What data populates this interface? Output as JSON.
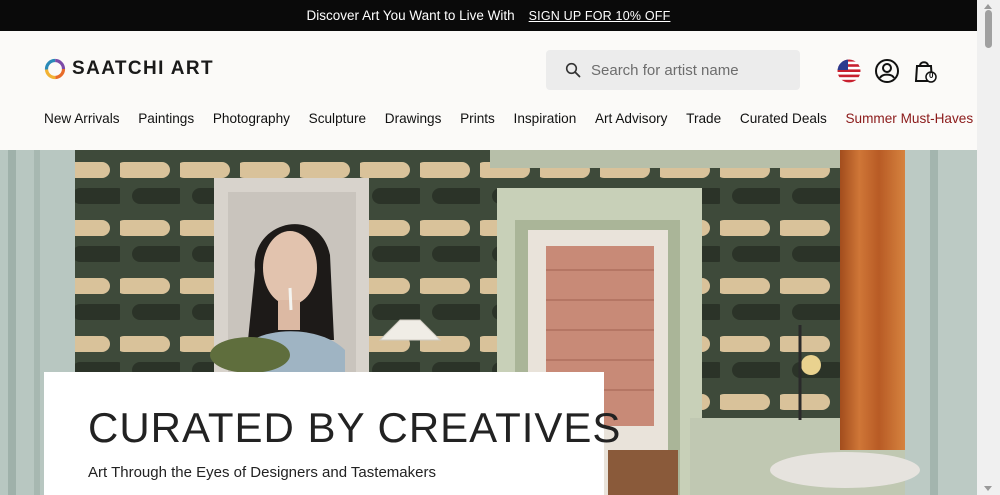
{
  "promo": {
    "message": "Discover Art You Want to Live With",
    "cta": "SIGN UP FOR 10% OFF"
  },
  "header": {
    "logo_text": "SAATCHI ART",
    "search_placeholder": "Search for artist name",
    "icons": [
      "us-flag-icon",
      "account-icon",
      "cart-icon"
    ],
    "cart_count": "0"
  },
  "nav": {
    "items": [
      "New Arrivals",
      "Paintings",
      "Photography",
      "Sculpture",
      "Drawings",
      "Prints",
      "Inspiration",
      "Art Advisory",
      "Trade",
      "Curated Deals",
      "Summer Must-Haves"
    ]
  },
  "hero": {
    "title": "CURATED BY CREATIVES",
    "subtitle": "Art Through the Eyes of Designers and Tastemakers"
  },
  "colors": {
    "promo_bg": "#0a0a0a",
    "accent_nav": "#8b1a1a",
    "wall_green": "#3e4a3a",
    "stripe_beige": "#d9c29a",
    "curtain_orange": "#c0632a"
  }
}
